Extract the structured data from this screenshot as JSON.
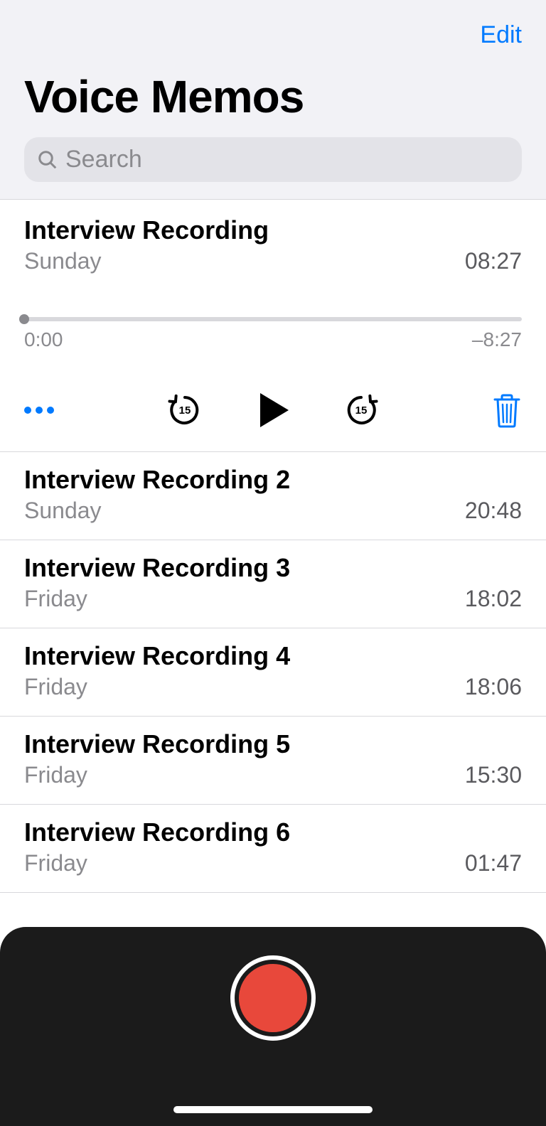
{
  "header": {
    "edit_label": "Edit",
    "title": "Voice Memos",
    "search_placeholder": "Search"
  },
  "selected": {
    "title": "Interview Recording",
    "day": "Sunday",
    "duration": "08:27",
    "elapsed": "0:00",
    "remaining": "–8:27",
    "skip_seconds": "15"
  },
  "recordings": [
    {
      "title": "Interview Recording 2",
      "day": "Sunday",
      "duration": "20:48"
    },
    {
      "title": "Interview Recording 3",
      "day": "Friday",
      "duration": "18:02"
    },
    {
      "title": "Interview Recording 4",
      "day": "Friday",
      "duration": "18:06"
    },
    {
      "title": "Interview Recording 5",
      "day": "Friday",
      "duration": "15:30"
    },
    {
      "title": "Interview Recording 6",
      "day": "Friday",
      "duration": "01:47"
    }
  ]
}
